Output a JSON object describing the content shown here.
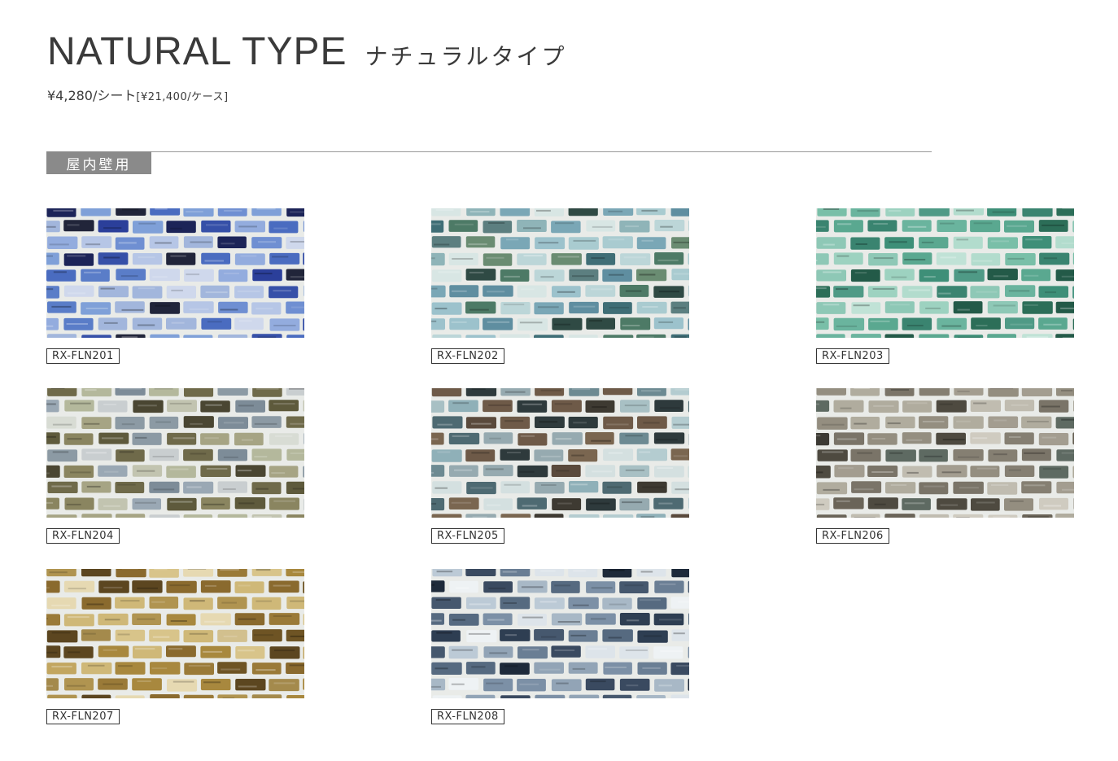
{
  "header": {
    "title_en": "NATURAL TYPE",
    "title_ja": "ナチュラルタイプ",
    "price_sheet": "¥4,280/シート",
    "price_case": "[¥21,400/ケース]"
  },
  "section": {
    "label": "屋内壁用"
  },
  "colors": {
    "grout": "#e9ebe8",
    "rule": "#999999",
    "tag_bg": "#8a8a8a"
  },
  "tiles": [
    {
      "code": "RX-FLN201",
      "palette": [
        "#2b3f9a",
        "#4a6cc0",
        "#6f8fd2",
        "#93acde",
        "#b6c6e6",
        "#cfd8ec",
        "#1c2458",
        "#3650a8",
        "#7fa0d8",
        "#5a7dc8",
        "#a2b6dc",
        "#21253a"
      ]
    },
    {
      "code": "RX-FLN202",
      "palette": [
        "#5f8ea0",
        "#7aa7b6",
        "#9cc2cc",
        "#bcd6d8",
        "#d8e6e4",
        "#3f6e76",
        "#4d7a66",
        "#6a8c72",
        "#8fb4b8",
        "#2f4a44",
        "#a9cbd0",
        "#5c7f80"
      ]
    },
    {
      "code": "RX-FLN203",
      "palette": [
        "#3e8f78",
        "#5aa890",
        "#79bfa8",
        "#9dd2c0",
        "#c0e2d6",
        "#2c6e58",
        "#4f9a86",
        "#8ec8b6",
        "#6ab49e",
        "#235a48",
        "#b2dccd",
        "#3a8470"
      ]
    },
    {
      "code": "RX-FLN204",
      "palette": [
        "#6f6a4a",
        "#8a8560",
        "#a6a484",
        "#c2c4b0",
        "#d8dcd4",
        "#9aa8b4",
        "#7d8c98",
        "#5e5a3c",
        "#b4b89c",
        "#4a4632",
        "#c9ced0",
        "#8c9aa4"
      ]
    },
    {
      "code": "RX-FLN205",
      "palette": [
        "#4e6a72",
        "#6d8a92",
        "#8fb0b8",
        "#b4ccd0",
        "#d4e0e0",
        "#5a4a3c",
        "#3e3a32",
        "#7a6650",
        "#96aab0",
        "#2e3a3c",
        "#6e5a48",
        "#a8c0c4"
      ]
    },
    {
      "code": "RX-FLN206",
      "palette": [
        "#6a6458",
        "#857f72",
        "#a39d90",
        "#c0bcb0",
        "#dad8d0",
        "#4e4a40",
        "#5e6a62",
        "#3c3a34",
        "#948e80",
        "#b0ac9e",
        "#7a7468",
        "#cfcbc0"
      ]
    },
    {
      "code": "RX-FLN207",
      "palette": [
        "#8a6a2e",
        "#a8883e",
        "#c2a660",
        "#d8c48a",
        "#e6d9b2",
        "#6e5424",
        "#b09450",
        "#9a7a38",
        "#cfb878",
        "#5c4620",
        "#d2c08e",
        "#a48a4c"
      ]
    },
    {
      "code": "RX-FLN208",
      "palette": [
        "#2e3e52",
        "#46586e",
        "#6a7e94",
        "#92a4b6",
        "#bccad6",
        "#dde4ea",
        "#1e2a3a",
        "#566a80",
        "#7c90a6",
        "#3a4a60",
        "#a8b8c6",
        "#eef2f4"
      ]
    }
  ]
}
